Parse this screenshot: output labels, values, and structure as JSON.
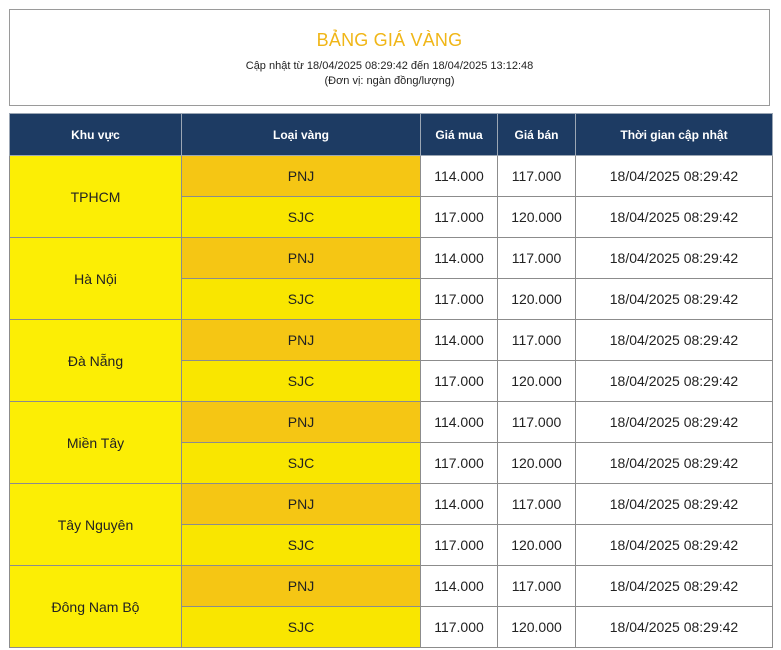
{
  "header": {
    "title": "BẢNG GIÁ VÀNG",
    "updated": "Cập nhật từ 18/04/2025 08:29:42 đến 18/04/2025 13:12:48",
    "unit": "(Đơn vị: ngàn đồng/lượng)"
  },
  "table": {
    "columns": [
      "Khu vực",
      "Loại vàng",
      "Giá mua",
      "Giá bán",
      "Thời gian cập nhật"
    ],
    "regions": [
      {
        "name": "TPHCM",
        "rows": [
          {
            "type": "PNJ",
            "buy": "114.000",
            "sell": "117.000",
            "time": "18/04/2025 08:29:42"
          },
          {
            "type": "SJC",
            "buy": "117.000",
            "sell": "120.000",
            "time": "18/04/2025 08:29:42"
          }
        ]
      },
      {
        "name": "Hà Nội",
        "rows": [
          {
            "type": "PNJ",
            "buy": "114.000",
            "sell": "117.000",
            "time": "18/04/2025 08:29:42"
          },
          {
            "type": "SJC",
            "buy": "117.000",
            "sell": "120.000",
            "time": "18/04/2025 08:29:42"
          }
        ]
      },
      {
        "name": "Đà Nẵng",
        "rows": [
          {
            "type": "PNJ",
            "buy": "114.000",
            "sell": "117.000",
            "time": "18/04/2025 08:29:42"
          },
          {
            "type": "SJC",
            "buy": "117.000",
            "sell": "120.000",
            "time": "18/04/2025 08:29:42"
          }
        ]
      },
      {
        "name": "Miền Tây",
        "rows": [
          {
            "type": "PNJ",
            "buy": "114.000",
            "sell": "117.000",
            "time": "18/04/2025 08:29:42"
          },
          {
            "type": "SJC",
            "buy": "117.000",
            "sell": "120.000",
            "time": "18/04/2025 08:29:42"
          }
        ]
      },
      {
        "name": "Tây Nguyên",
        "rows": [
          {
            "type": "PNJ",
            "buy": "114.000",
            "sell": "117.000",
            "time": "18/04/2025 08:29:42"
          },
          {
            "type": "SJC",
            "buy": "117.000",
            "sell": "120.000",
            "time": "18/04/2025 08:29:42"
          }
        ]
      },
      {
        "name": "Đông Nam Bộ",
        "rows": [
          {
            "type": "PNJ",
            "buy": "114.000",
            "sell": "117.000",
            "time": "18/04/2025 08:29:42"
          },
          {
            "type": "SJC",
            "buy": "117.000",
            "sell": "120.000",
            "time": "18/04/2025 08:29:42"
          }
        ]
      }
    ]
  },
  "colors": {
    "title": "#f0b617",
    "header_bg": "#1d3b63",
    "region_bg": "#fcee05",
    "pnj_bg": "#f5c614",
    "sjc_bg": "#f9e600"
  }
}
